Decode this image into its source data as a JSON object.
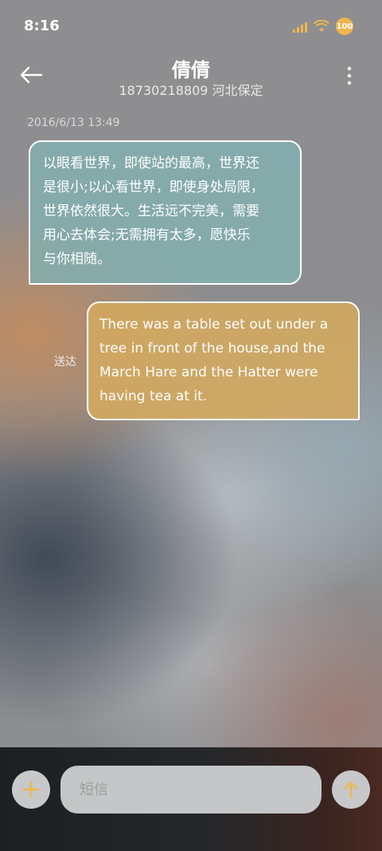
{
  "status_bar": {
    "time": "8:16",
    "battery": "100",
    "accent": "#f0b54d"
  },
  "header": {
    "contact_name": "倩倩",
    "contact_detail": "18730218809 河北保定"
  },
  "conversation": {
    "timestamp": "2016/6/13 13:49",
    "messages": [
      {
        "direction": "incoming",
        "lines": [
          "以眼看世界，即使站的最高，世界还",
          "是很小;以心看世界，即使身处局限，",
          "世界依然很大。生活远不完美，需要",
          "用心去体会;无需拥有太多，愿快乐",
          "与你相随。"
        ]
      },
      {
        "direction": "outgoing",
        "status": "送达",
        "lines": [
          "There was a table set out under a",
          "tree in front of the house,and the",
          "March Hare and the Hatter were",
          "having tea at it."
        ]
      }
    ]
  },
  "composer": {
    "placeholder": "短信",
    "accent": "#f0b54d"
  },
  "icons": {
    "back": "arrow-left-icon",
    "menu": "more-vertical-icon",
    "attach": "plus-icon",
    "send": "arrow-up-icon"
  }
}
